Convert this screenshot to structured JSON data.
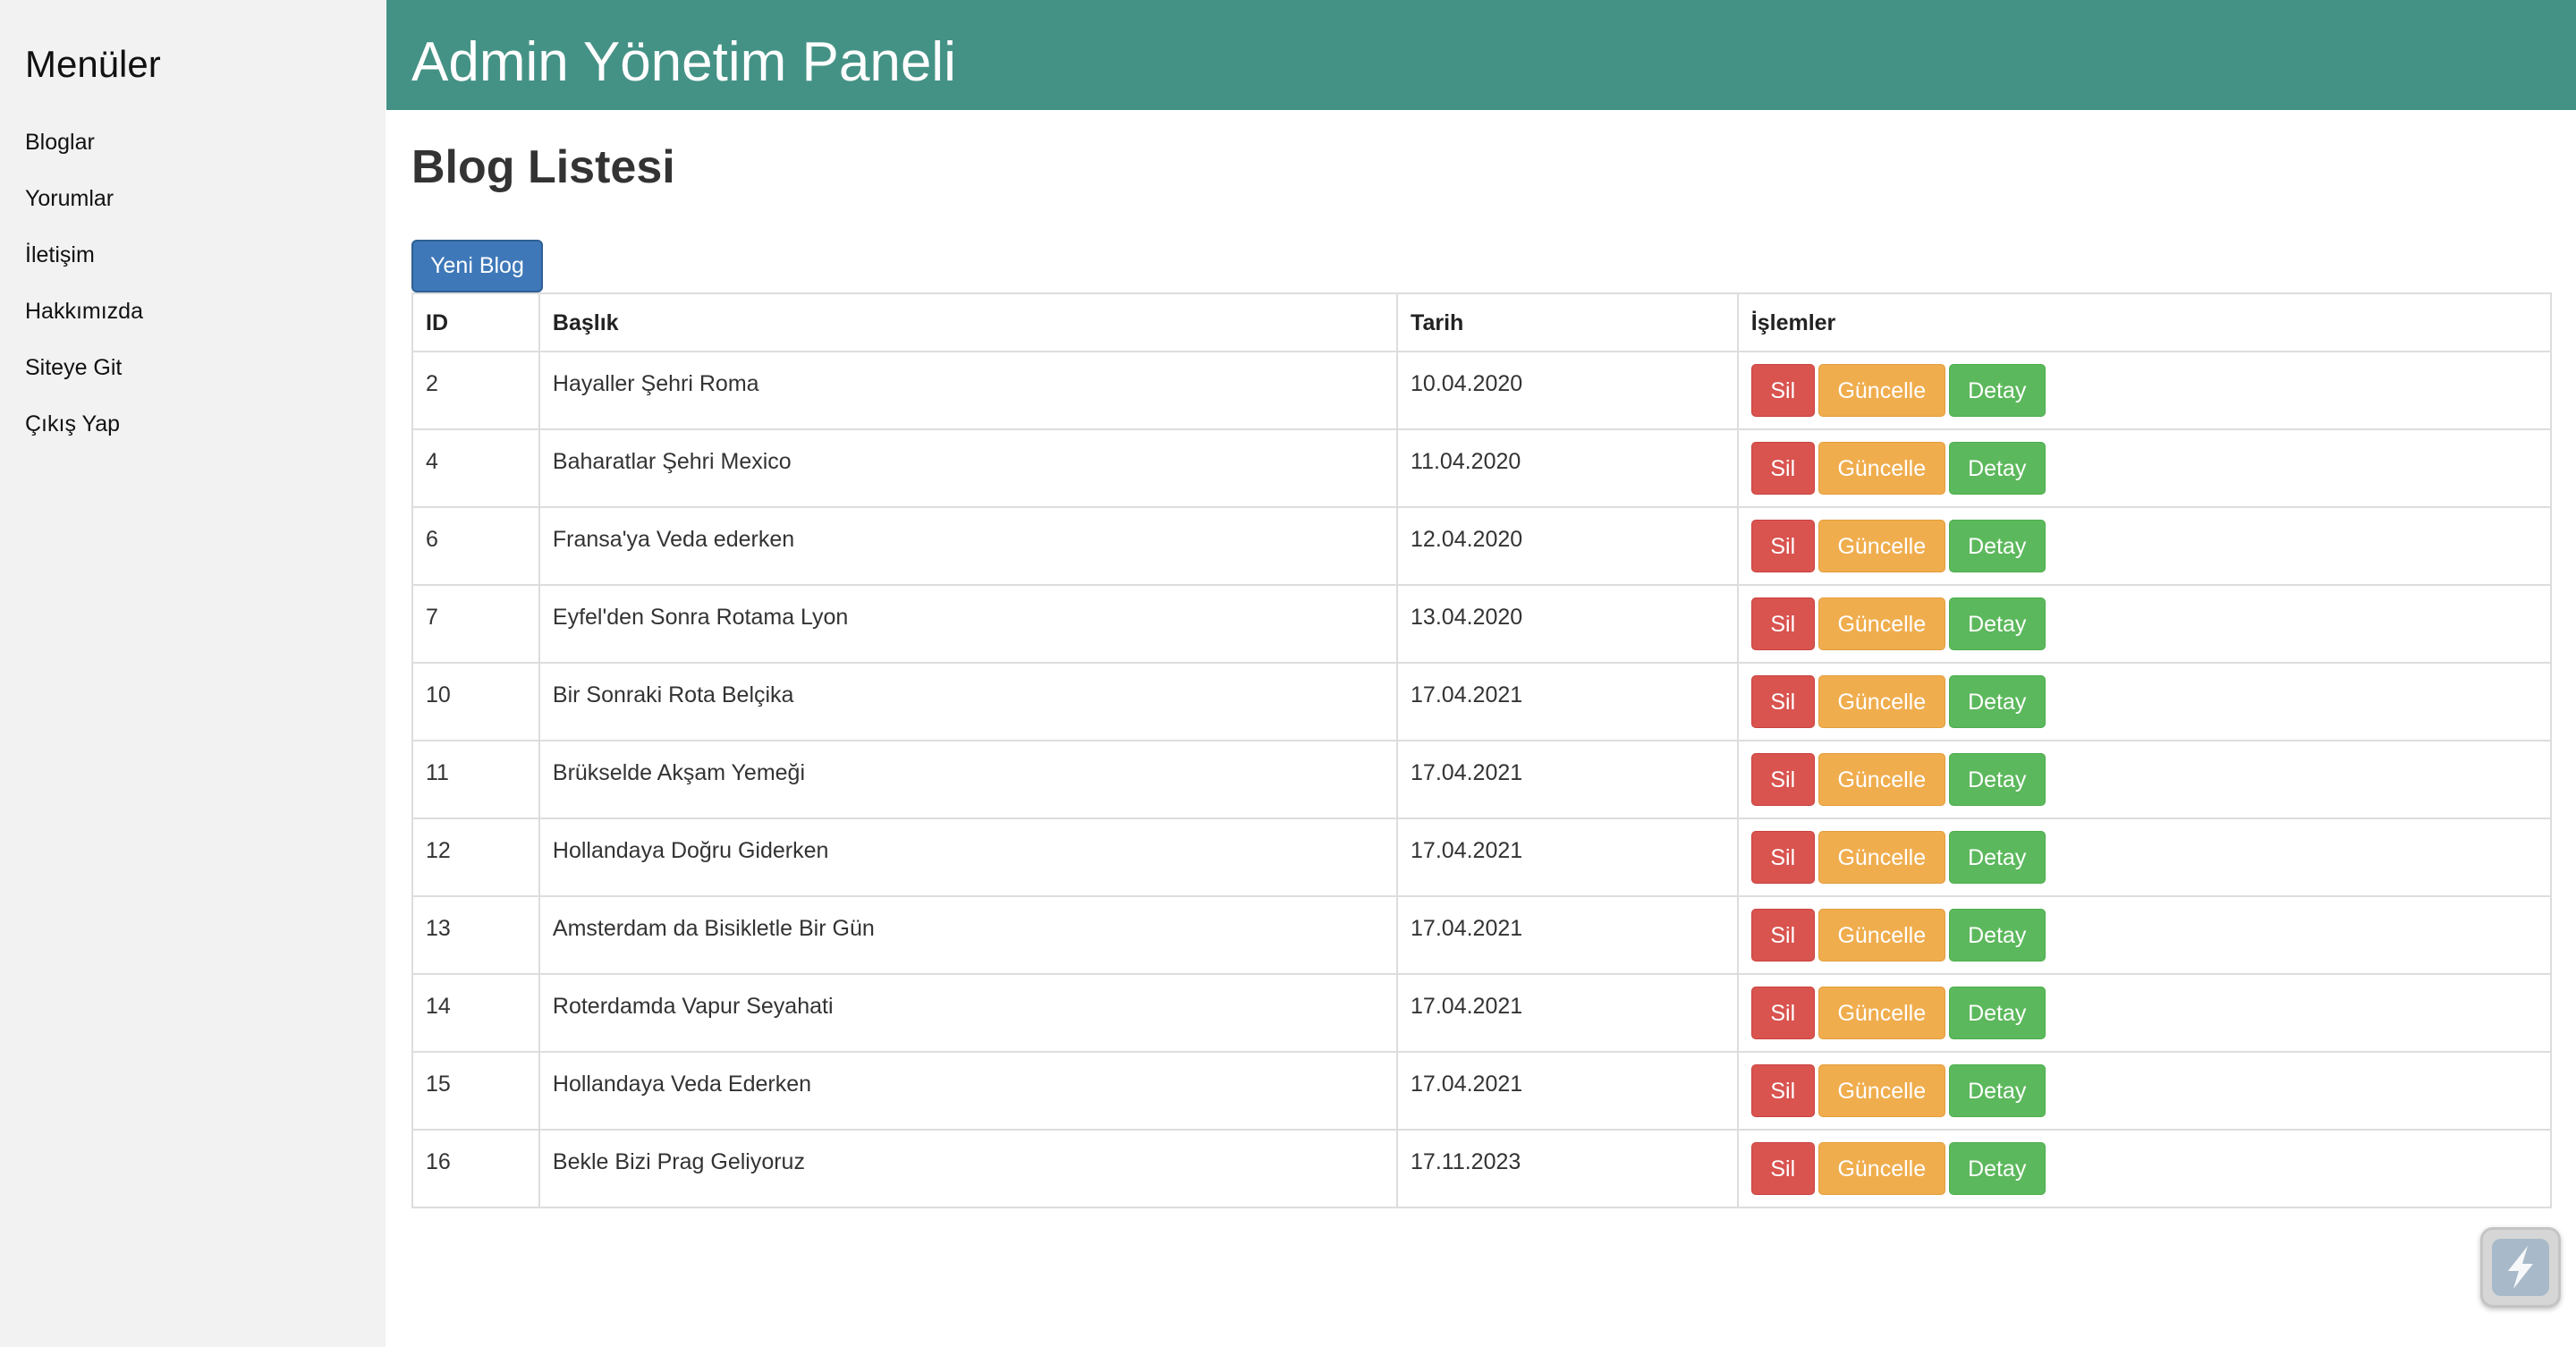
{
  "sidebar": {
    "title": "Menüler",
    "items": [
      {
        "label": "Bloglar"
      },
      {
        "label": "Yorumlar"
      },
      {
        "label": "İletişim"
      },
      {
        "label": "Hakkımızda"
      },
      {
        "label": "Siteye Git"
      },
      {
        "label": "Çıkış Yap"
      }
    ]
  },
  "header": {
    "title": "Admin Yönetim Paneli"
  },
  "main": {
    "page_title": "Blog Listesi",
    "new_button_label": "Yeni Blog",
    "table": {
      "columns": [
        "ID",
        "Başlık",
        "Tarih",
        "İşlemler"
      ],
      "rows": [
        {
          "id": "2",
          "title": "Hayaller Şehri Roma",
          "date": "10.04.2020"
        },
        {
          "id": "4",
          "title": "Baharatlar Şehri Mexico",
          "date": "11.04.2020"
        },
        {
          "id": "6",
          "title": "Fransa'ya Veda ederken",
          "date": "12.04.2020"
        },
        {
          "id": "7",
          "title": "Eyfel'den Sonra Rotama Lyon",
          "date": "13.04.2020"
        },
        {
          "id": "10",
          "title": "Bir Sonraki Rota Belçika",
          "date": "17.04.2021"
        },
        {
          "id": "11",
          "title": "Brükselde Akşam Yemeği",
          "date": "17.04.2021"
        },
        {
          "id": "12",
          "title": "Hollandaya Doğru Giderken",
          "date": "17.04.2021"
        },
        {
          "id": "13",
          "title": "Amsterdam da Bisikletle Bir Gün",
          "date": "17.04.2021"
        },
        {
          "id": "14",
          "title": "Roterdamda Vapur Seyahati",
          "date": "17.04.2021"
        },
        {
          "id": "15",
          "title": "Hollandaya Veda Ederken",
          "date": "17.04.2021"
        },
        {
          "id": "16",
          "title": "Bekle Bizi Prag Geliyoruz",
          "date": "17.11.2023"
        }
      ],
      "actions": {
        "delete_label": "Sil",
        "update_label": "Güncelle",
        "detail_label": "Detay"
      }
    }
  },
  "colors": {
    "header_bg": "#449285",
    "sidebar_bg": "#f2f2f2",
    "primary": "#3e78b8",
    "danger": "#d9534f",
    "warning": "#f0ad4e",
    "success": "#5cb85c"
  },
  "icons": {
    "floating_widget": "bolt-icon"
  }
}
